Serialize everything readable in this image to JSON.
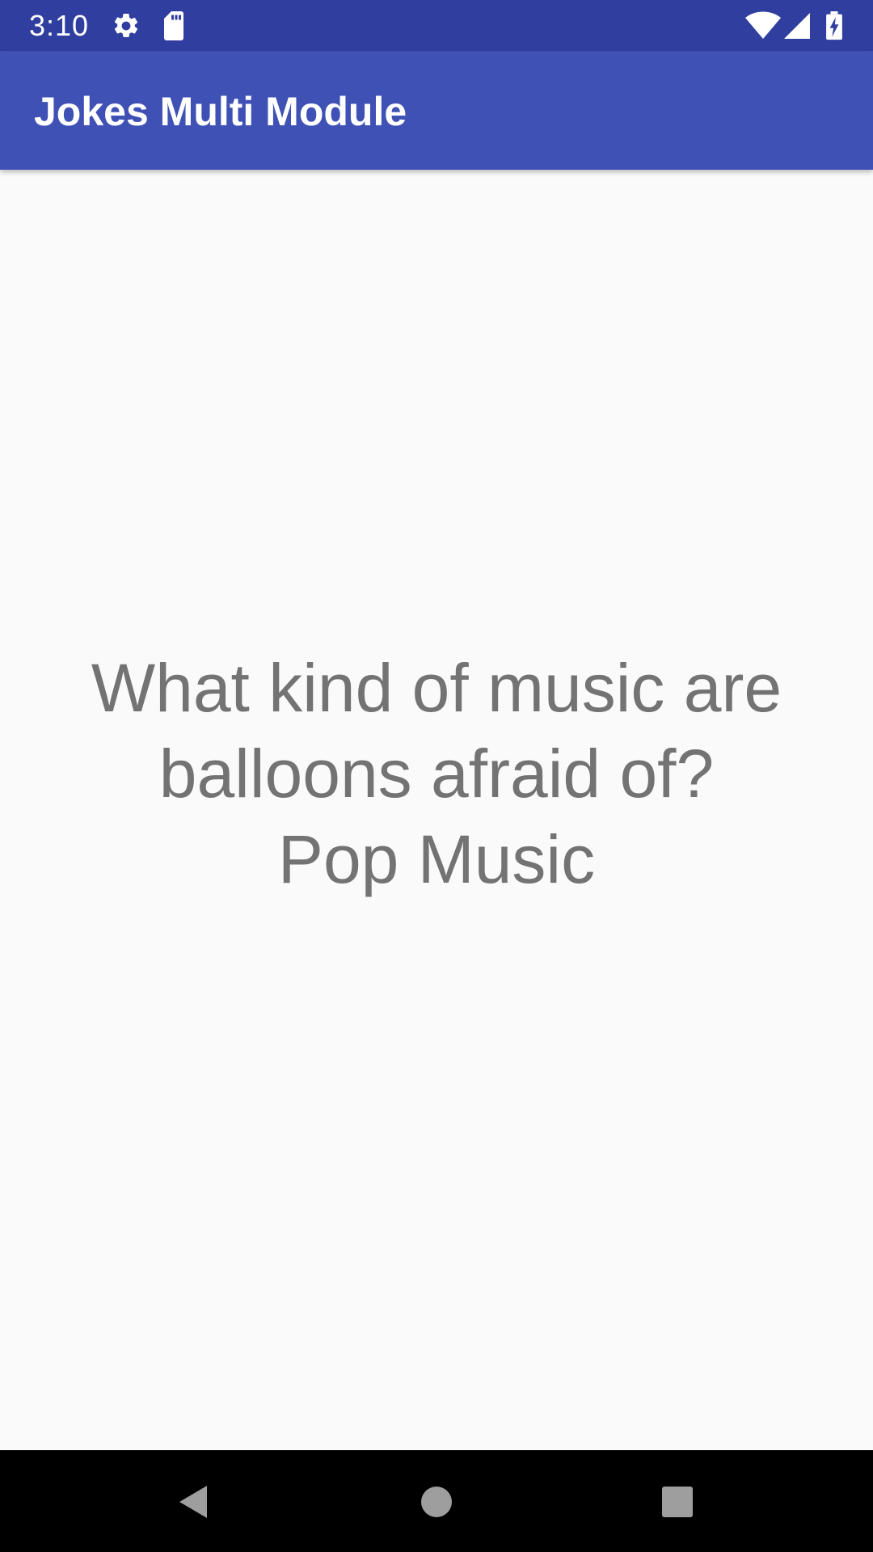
{
  "status_bar": {
    "time": "3:10",
    "icons": [
      "gear-icon",
      "sd-card-icon",
      "wifi-icon",
      "cell-signal-icon",
      "battery-charging-icon"
    ],
    "background_color": "#303f9f"
  },
  "app_bar": {
    "title": "Jokes Multi Module",
    "background_color": "#3f51b5"
  },
  "content": {
    "joke": "What kind of music are balloons afraid of?\nPop Music",
    "text_color": "#737373"
  },
  "nav_bar": {
    "buttons": [
      "back-icon",
      "home-icon",
      "recents-icon"
    ]
  }
}
